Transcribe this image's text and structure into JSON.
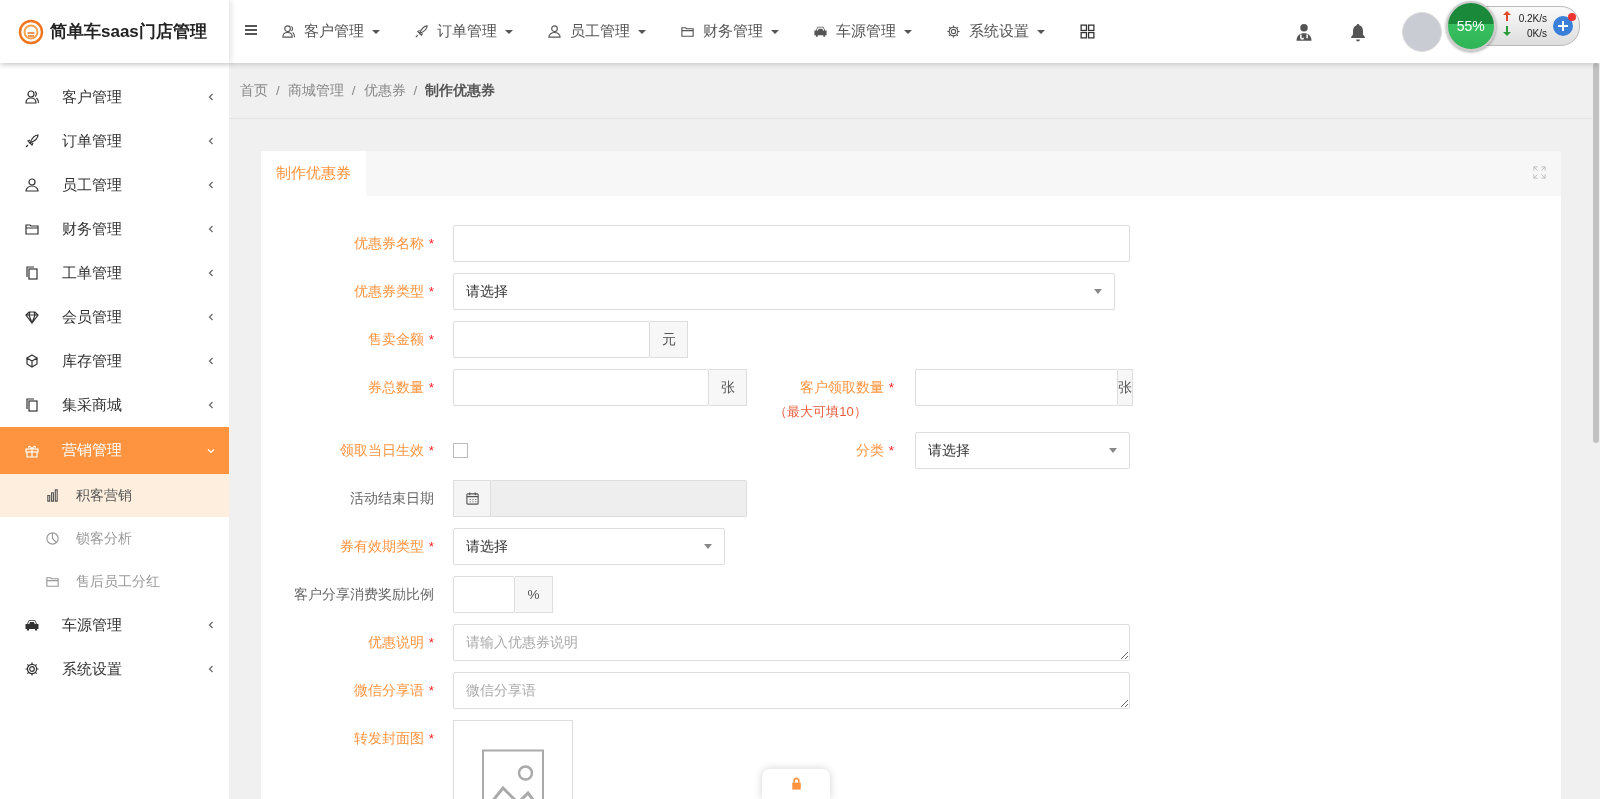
{
  "brand": {
    "title": "简单车saas门店管理"
  },
  "top_nav": [
    {
      "label": "客户管理"
    },
    {
      "label": "订单管理"
    },
    {
      "label": "员工管理"
    },
    {
      "label": "财务管理"
    },
    {
      "label": "车源管理"
    },
    {
      "label": "系统设置"
    }
  ],
  "speed_widget": {
    "percent": "55%",
    "upload": "0.2K/s",
    "download": "0K/s"
  },
  "sidebar": {
    "items": [
      {
        "label": "客户管理",
        "selected": false,
        "expanded": false
      },
      {
        "label": "订单管理",
        "selected": false,
        "expanded": false
      },
      {
        "label": "员工管理",
        "selected": false,
        "expanded": false
      },
      {
        "label": "财务管理",
        "selected": false,
        "expanded": false
      },
      {
        "label": "工单管理",
        "selected": false,
        "expanded": false
      },
      {
        "label": "会员管理",
        "selected": false,
        "expanded": false
      },
      {
        "label": "库存管理",
        "selected": false,
        "expanded": false
      },
      {
        "label": "集采商城",
        "selected": false,
        "expanded": false
      },
      {
        "label": "营销管理",
        "selected": true,
        "expanded": true,
        "children": [
          {
            "label": "积客营销",
            "selected": true
          },
          {
            "label": "锁客分析",
            "selected": false
          },
          {
            "label": "售后员工分红",
            "selected": false
          }
        ]
      },
      {
        "label": "车源管理",
        "selected": false,
        "expanded": false
      },
      {
        "label": "系统设置",
        "selected": false,
        "expanded": false
      }
    ]
  },
  "breadcrumb": {
    "separator": "/",
    "items": [
      "首页",
      "商城管理",
      "优惠券",
      "制作优惠券"
    ]
  },
  "card": {
    "tab": "制作优惠券",
    "required_mark": "*",
    "rows": [
      {
        "fields": [
          {
            "kind": "text",
            "label": "优惠券名称",
            "required": true
          }
        ]
      },
      {
        "fields": [
          {
            "kind": "select",
            "label": "优惠券类型",
            "required": true,
            "value": "请选择"
          }
        ]
      },
      {
        "fields": [
          {
            "kind": "addon",
            "label": "售卖金额",
            "required": true,
            "addon": "元"
          }
        ]
      },
      {
        "fields": [
          {
            "kind": "addon",
            "label": "券总数量",
            "required": true,
            "addon": "张"
          },
          {
            "kind": "addon",
            "label": "客户领取数量",
            "required": true,
            "note": "（最大可填10）",
            "addon": "张"
          }
        ]
      },
      {
        "fields": [
          {
            "kind": "checkbox",
            "label": "领取当日生效",
            "required": true,
            "checked": false
          },
          {
            "kind": "select",
            "label": "分类",
            "required": true,
            "value": "请选择"
          }
        ]
      },
      {
        "fields": [
          {
            "kind": "date",
            "label": "活动结束日期",
            "required": false,
            "disabled": true
          }
        ]
      },
      {
        "fields": [
          {
            "kind": "select",
            "label": "券有效期类型",
            "required": true,
            "value": "请选择"
          }
        ]
      },
      {
        "fields": [
          {
            "kind": "addon",
            "label": "客户分享消费奖励比例",
            "required": false,
            "addon": "%"
          }
        ]
      },
      {
        "fields": [
          {
            "kind": "textarea",
            "label": "优惠说明",
            "required": true,
            "placeholder": "请输入优惠券说明"
          }
        ]
      },
      {
        "fields": [
          {
            "kind": "textarea",
            "label": "微信分享语",
            "required": true,
            "placeholder": "微信分享语"
          }
        ]
      },
      {
        "fields": [
          {
            "kind": "image",
            "label": "转发封面图",
            "required": true
          }
        ]
      }
    ]
  }
}
